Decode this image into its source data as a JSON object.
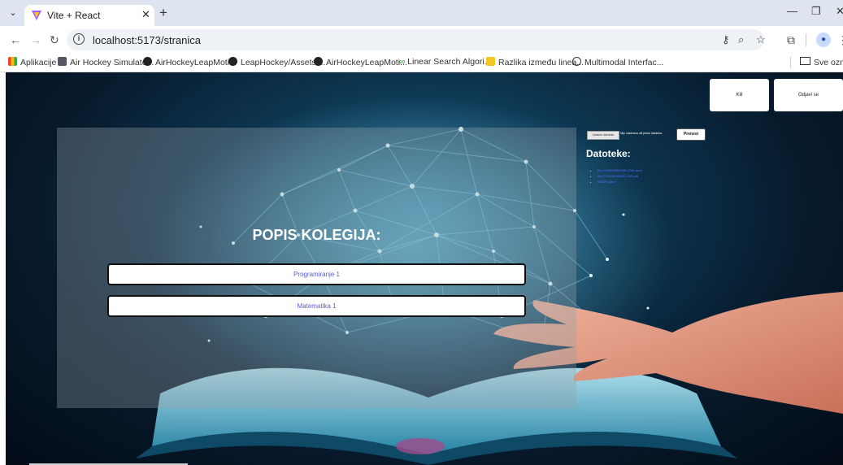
{
  "browser": {
    "tab_title": "Vite + React",
    "url": "localhost:5173/stranica",
    "bookmarks": [
      {
        "label": "Aplikacije",
        "icon": "apps-grid-icon"
      },
      {
        "label": "Air Hockey Simulato...",
        "icon": "app-icon"
      },
      {
        "label": "AirHockeyLeapMoti...",
        "icon": "github-icon"
      },
      {
        "label": "LeapHockey/Assets/...",
        "icon": "github-icon"
      },
      {
        "label": "AirHockeyLeapMoti...",
        "icon": "github-icon"
      },
      {
        "label": "Linear Search Algori...",
        "icon": "infinity-icon"
      },
      {
        "label": "Razlika između linea...",
        "icon": "note-icon"
      },
      {
        "label": "Multimodal Interfac...",
        "icon": "globe-icon"
      }
    ],
    "all_bookmarks": "Sve oznak"
  },
  "header": {
    "btn1": "Klil",
    "btn2": "Odjavi se"
  },
  "upload": {
    "choose": "Odaberi datoteke",
    "none": "Nije odabrana niti jedna datoteka.",
    "submit": "Prenesi"
  },
  "files": {
    "title": "Datoteke:",
    "items": [
      "file-1724823896768-1766.docx",
      "file-1724489164621-195.pdf",
      "SHIZFt.docx"
    ]
  },
  "courses": {
    "title": "POPIS KOLEGIJA:",
    "items": [
      "Programiranje 1",
      "Matematika 1"
    ]
  }
}
